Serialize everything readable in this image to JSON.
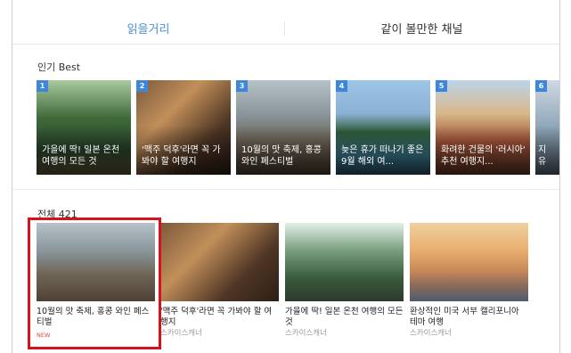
{
  "tabs": [
    {
      "label": "읽을거리"
    },
    {
      "label": "같이 볼만한 채널"
    }
  ],
  "popular": {
    "label": "인기 Best",
    "items": [
      {
        "rank": "1",
        "title": "가을에 딱! 일본 온천 여행의 모든 것"
      },
      {
        "rank": "2",
        "title": "'맥주 덕후'라면 꼭 가봐야 할 여행지"
      },
      {
        "rank": "3",
        "title": "10월의 맛 축제, 홍콩 와인 페스티벌"
      },
      {
        "rank": "4",
        "title": "늦은 휴가 떠나기 좋은 9월 해외 여..."
      },
      {
        "rank": "5",
        "title": "화려한 건물의 '러시아' 추천 여행지..."
      },
      {
        "rank": "6",
        "title": "지 유"
      }
    ]
  },
  "all": {
    "label": "전체 421",
    "items": [
      {
        "title": "10월의 맛 축제, 홍콩 와인 페스티벌",
        "source": "",
        "badge": "NEW"
      },
      {
        "title": "'맥주 덕후'라면 꼭 가봐야 할 여행지",
        "source": "스카이스캐너",
        "badge": ""
      },
      {
        "title": "가을에 딱! 일본 온천 여행의 모든 것",
        "source": "스카이스캐너",
        "badge": ""
      },
      {
        "title": "환상적인 미국 서부 캘리포니아 테마 여행",
        "source": "스카이스캐너",
        "badge": ""
      }
    ]
  },
  "colors": {
    "accent_tab": "#4a8fd8",
    "rank_badge": "#3d86d9",
    "highlight_border": "#d6121c",
    "new_badge": "#e2453c"
  }
}
